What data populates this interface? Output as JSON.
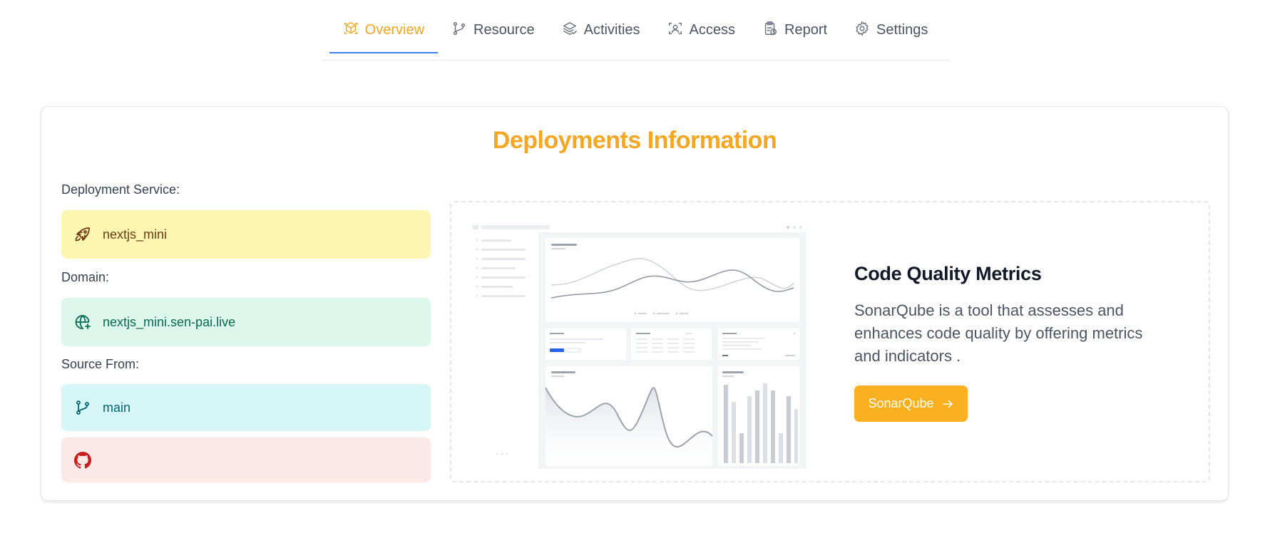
{
  "tabs": [
    {
      "label": "Overview",
      "icon": "cube-icon",
      "active": true
    },
    {
      "label": "Resource",
      "icon": "git-branch-icon",
      "active": false
    },
    {
      "label": "Activities",
      "icon": "layers-icon",
      "active": false
    },
    {
      "label": "Access",
      "icon": "scan-face-icon",
      "active": false
    },
    {
      "label": "Report",
      "icon": "clipboard-clock-icon",
      "active": false
    },
    {
      "label": "Settings",
      "icon": "gear-icon",
      "active": false
    }
  ],
  "card": {
    "title": "Deployments Information",
    "deployment_service_label": "Deployment Service:",
    "deployment_service_value": "nextjs_mini",
    "domain_label": "Domain:",
    "domain_value": "nextjs_mini.sen-pai.live",
    "source_label": "Source From:",
    "source_value": "main"
  },
  "promo": {
    "title": "Code Quality Metrics",
    "description": "SonarQube is a tool that assesses and enhances code quality by offering metrics and indicators .",
    "button_label": "SonarQube"
  },
  "colors": {
    "accent": "#f5a623",
    "button": "#fbb01f",
    "active_underline": "#3b82f6"
  }
}
